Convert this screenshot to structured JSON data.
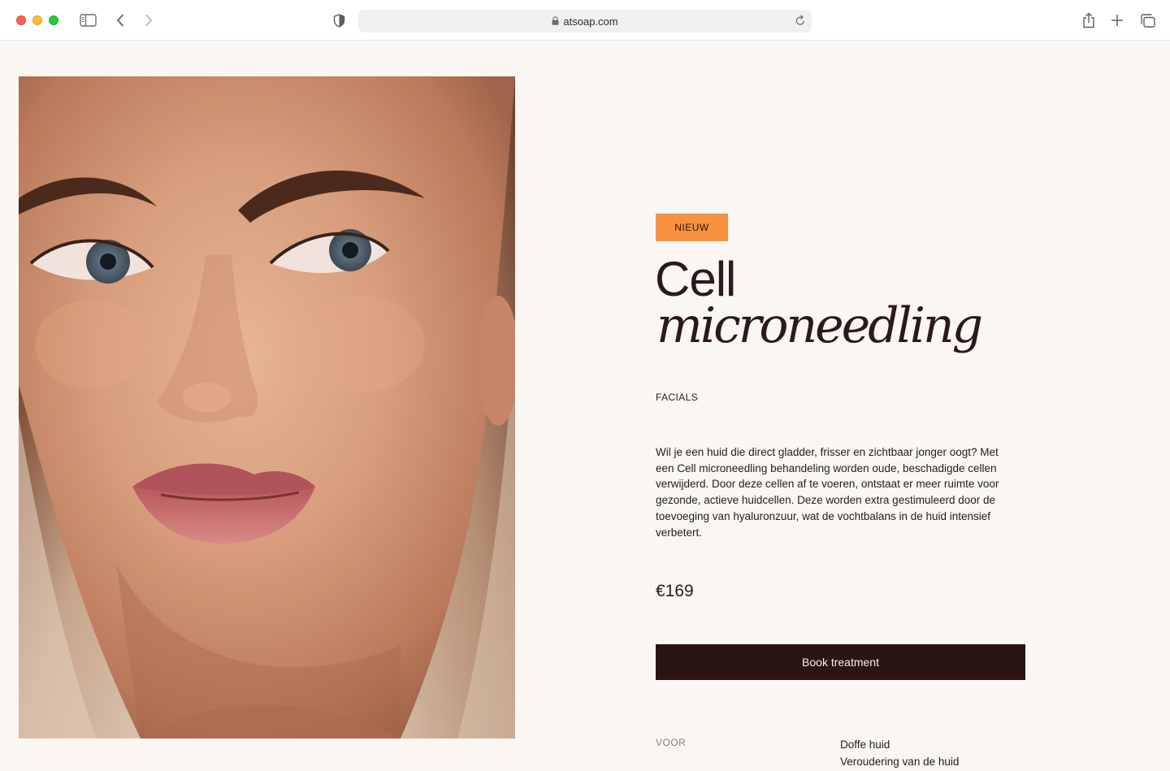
{
  "browser": {
    "url": "atsoap.com"
  },
  "product": {
    "badge": "NIEUW",
    "title_line1": "Cell",
    "title_line2": "microneedling",
    "category": "FACIALS",
    "description": "Wil je een huid die direct gladder, frisser en zichtbaar jonger oogt? Met een Cell microneedling behandeling worden oude, beschadigde cellen verwijderd. Door deze cellen af te voeren, ontstaat er meer ruimte voor gezonde, actieve huidcellen. Deze worden extra gestimuleerd door de toevoeging van hyaluronzuur, wat de vochtbalans in de huid intensief verbetert.",
    "price": "€169",
    "book_button": "Book treatment",
    "for_label": "VOOR",
    "for_items": [
      "Doffe huid",
      "Veroudering van de huid"
    ]
  },
  "colors": {
    "page_background": "#faf6f3",
    "badge": "#f7913f",
    "button": "#2a1512",
    "text": "#2b1a16"
  },
  "icons": {
    "sidebar": "sidebar-icon",
    "back": "chevron-left-icon",
    "forward": "chevron-right-icon",
    "privacy": "shield-icon",
    "lock": "lock-icon",
    "reload": "reload-icon",
    "share": "share-icon",
    "new_tab": "plus-icon",
    "tabs": "tab-overview-icon"
  }
}
